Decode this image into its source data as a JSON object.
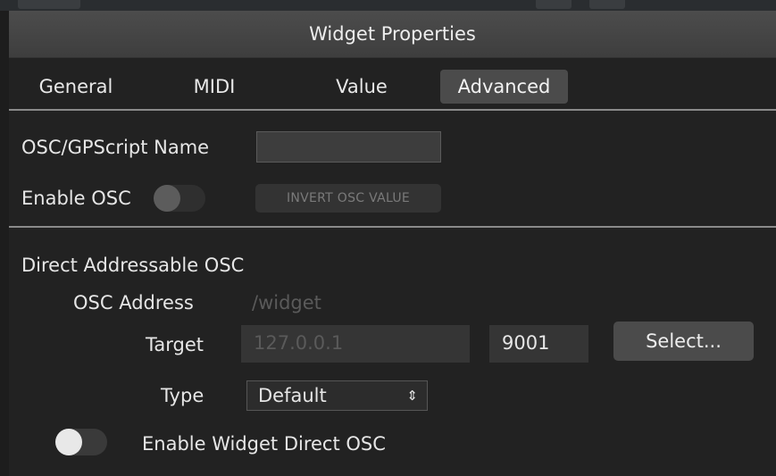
{
  "window": {
    "title": "Widget Properties"
  },
  "tabs": [
    {
      "label": "General",
      "active": false
    },
    {
      "label": "MIDI",
      "active": false
    },
    {
      "label": "Value",
      "active": false
    },
    {
      "label": "Advanced",
      "active": true
    }
  ],
  "osc": {
    "name_label": "OSC/GPScript Name",
    "name_value": "",
    "enable_label": "Enable OSC",
    "enable_on": false,
    "invert_label": "INVERT OSC VALUE"
  },
  "direct": {
    "section_title": "Direct Addressable OSC",
    "address_label": "OSC Address",
    "address_value": "/widget",
    "target_label": "Target",
    "target_ip": "127.0.0.1",
    "target_port": "9001",
    "select_label": "Select...",
    "type_label": "Type",
    "type_value": "Default",
    "type_arrows": "⇕",
    "enable_direct_label": "Enable Widget Direct OSC",
    "enable_direct_on": false
  },
  "colors": {
    "panel": "#222222",
    "titlebar": "#454545",
    "active_tab": "#4b4b4b"
  }
}
